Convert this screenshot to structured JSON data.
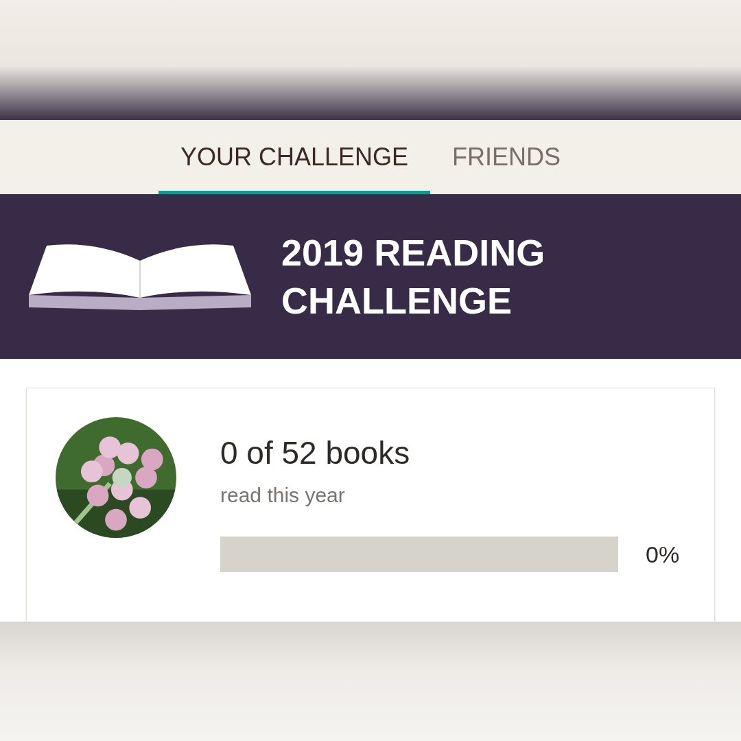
{
  "tabs": [
    {
      "label": "YOUR CHALLENGE",
      "selected": true
    },
    {
      "label": "FRIENDS",
      "selected": false
    }
  ],
  "banner": {
    "title": "2019 READING CHALLENGE"
  },
  "progress": {
    "count": "0 of 52 books",
    "subtitle": "read this year",
    "percent": "0%"
  }
}
